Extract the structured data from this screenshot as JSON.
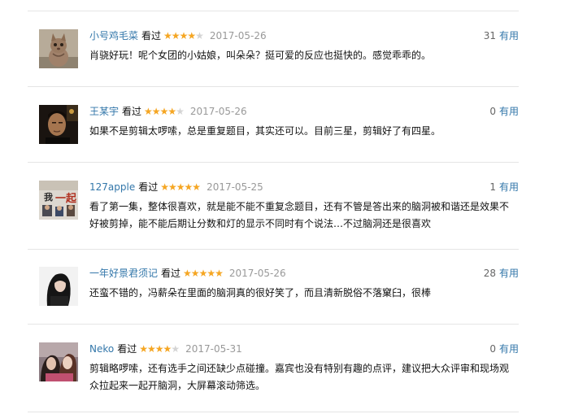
{
  "comments": [
    {
      "avatar": "cat-avatar",
      "user": "小号鸡毛菜",
      "watched": "看过",
      "rating": 4,
      "date": "2017-05-26",
      "votes": "31",
      "useful": "有用",
      "text": "肖骁好玩！呢个女团的小姑娘，叫朵朵？挺可爱的反应也挺快的。感觉乖乖的。"
    },
    {
      "avatar": "man-avatar",
      "user": "王某宇",
      "watched": "看过",
      "rating": 4,
      "date": "2017-05-26",
      "votes": "0",
      "useful": "有用",
      "text": "如果不是剪辑太啰嗦，总是重复题目，其实还可以。目前三星，剪辑好了有四星。"
    },
    {
      "avatar": "poster-avatar",
      "user": "127apple",
      "watched": "看过",
      "rating": 5,
      "date": "2017-05-25",
      "votes": "1",
      "useful": "有用",
      "text": "看了第一集，整体很喜欢，就是能不能不重复念题目，还有不管是答出来的脑洞被和谐还是效果不好被剪掉，能不能后期让分数和灯的显示不同时有个说法…不过脑洞还是很喜欢"
    },
    {
      "avatar": "woman-avatar",
      "user": "一年好景君须记",
      "watched": "看过",
      "rating": 5,
      "date": "2017-05-26",
      "votes": "28",
      "useful": "有用",
      "text": "还蛮不错的，冯薪朵在里面的脑洞真的很好笑了，而且清新脱俗不落窠臼，很棒"
    },
    {
      "avatar": "couple-avatar",
      "user": "Neko",
      "watched": "看过",
      "rating": 4,
      "date": "2017-05-31",
      "votes": "0",
      "useful": "有用",
      "text": "剪辑略啰嗦，还有选手之间还缺少点碰撞。嘉宾也没有特别有趣的点评，建议把大众评审和现场观众拉起来一起开脑洞，大屏幕滚动筛选。"
    }
  ]
}
